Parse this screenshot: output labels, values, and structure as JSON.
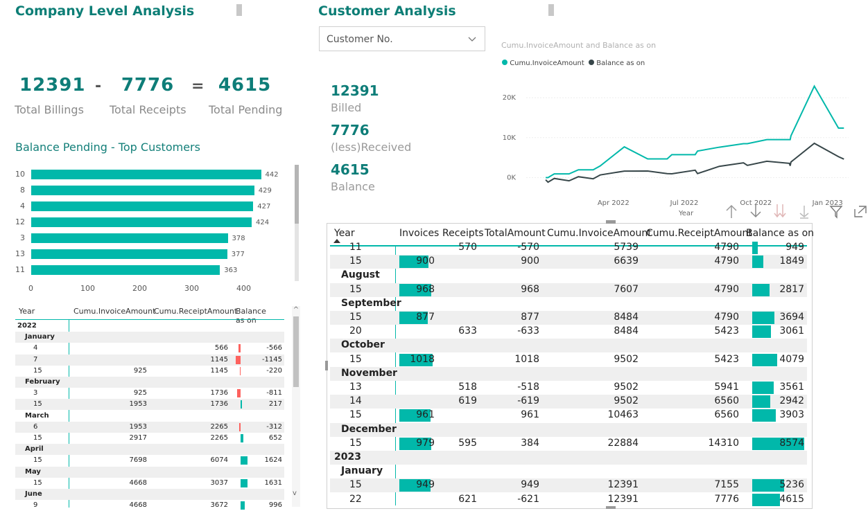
{
  "company": {
    "title": "Company Level Analysis",
    "kpis": {
      "billings": "12391",
      "receipts": "7776",
      "pending": "4615",
      "minus": "-",
      "equals": "=",
      "billings_label": "Total Billings",
      "receipts_label": "Total Receipts",
      "pending_label": "Total Pending"
    },
    "bar_title": "Balance Pending - Top Customers"
  },
  "customer": {
    "title": "Customer Analysis",
    "dropdown_placeholder": "Customer No.",
    "billed": "12391",
    "billed_label": "Billed",
    "received": "7776",
    "received_label": "(less)Received",
    "balance": "4615",
    "balance_label": "Balance",
    "line_title": "Cumu.InvoiceAmount and Balance as on",
    "legend_1": "Cumu.InvoiceAmount",
    "legend_2": "Balance as on",
    "x_axis_title": "Year",
    "x_ticks": [
      "Apr 2022",
      "Jul 2022",
      "Oct 2022",
      "Jan 2023"
    ],
    "y_ticks": [
      "20K",
      "10K",
      "0K"
    ]
  },
  "chart_data": [
    {
      "type": "bar",
      "orientation": "horizontal",
      "title": "Balance Pending - Top Customers",
      "categories": [
        "10",
        "8",
        "4",
        "12",
        "3",
        "13",
        "11"
      ],
      "values": [
        442,
        429,
        427,
        424,
        378,
        377,
        363
      ],
      "xlim": [
        0,
        460
      ],
      "x_ticks": [
        0,
        100,
        200,
        300,
        400
      ],
      "colors": {
        "bar": "#01b8aa"
      }
    },
    {
      "type": "line",
      "title": "Cumu.InvoiceAmount and Balance as on",
      "xlabel": "Year",
      "ylim": [
        -2000,
        24000
      ],
      "colors": {
        "Cumu.InvoiceAmount": "#01b8aa",
        "Balance as on": "#374649"
      },
      "series": [
        {
          "name": "Cumu.InvoiceAmount",
          "x": [
            "2022-01-04",
            "2022-01-07",
            "2022-01-15",
            "2022-02-03",
            "2022-02-15",
            "2022-03-06",
            "2022-03-15",
            "2022-04-15",
            "2022-05-15",
            "2022-06-09",
            "2022-06-15",
            "2022-07-15",
            "2022-07-18",
            "2022-08-15",
            "2022-09-15",
            "2022-09-20",
            "2022-10-15",
            "2022-11-13",
            "2022-11-14",
            "2022-11-15",
            "2022-12-15",
            "2023-01-15",
            "2023-01-22"
          ],
          "values": [
            0,
            0,
            925,
            925,
            1953,
            1953,
            2917,
            7698,
            4668,
            4668,
            5739,
            5739,
            6639,
            7607,
            8484,
            8484,
            9502,
            9502,
            9502,
            10463,
            22884,
            12391,
            12391
          ]
        },
        {
          "name": "Balance as on",
          "x": [
            "2022-01-04",
            "2022-01-07",
            "2022-01-15",
            "2022-02-03",
            "2022-02-15",
            "2022-03-06",
            "2022-03-15",
            "2022-04-15",
            "2022-05-15",
            "2022-06-09",
            "2022-06-15",
            "2022-07-15",
            "2022-07-18",
            "2022-08-15",
            "2022-09-15",
            "2022-09-20",
            "2022-10-15",
            "2022-11-13",
            "2022-11-14",
            "2022-11-15",
            "2022-12-15",
            "2023-01-15",
            "2023-01-22"
          ],
          "values": [
            -566,
            -1145,
            -220,
            -811,
            217,
            -312,
            652,
            1624,
            1631,
            996,
            949,
            1849,
            1000,
            2817,
            3694,
            3061,
            4079,
            3561,
            2942,
            3903,
            8574,
            5236,
            4615
          ]
        }
      ]
    }
  ],
  "left_matrix": {
    "headers": [
      "Year",
      "Cumu.InvoiceAmount",
      "Cumu.ReceiptAmount",
      "Balance as on"
    ],
    "rows": [
      {
        "label": "2022",
        "kind": "year"
      },
      {
        "label": "January",
        "kind": "month"
      },
      {
        "label": "4",
        "inv": "",
        "rec": "566",
        "bal": "-566",
        "bar": -566
      },
      {
        "label": "7",
        "inv": "",
        "rec": "1145",
        "bal": "-1145",
        "bar": -1145
      },
      {
        "label": "15",
        "inv": "925",
        "rec": "1145",
        "bal": "-220",
        "bar": -220
      },
      {
        "label": "February",
        "kind": "month"
      },
      {
        "label": "3",
        "inv": "925",
        "rec": "1736",
        "bal": "-811",
        "bar": -811
      },
      {
        "label": "15",
        "inv": "1953",
        "rec": "1736",
        "bal": "217",
        "bar": 217
      },
      {
        "label": "March",
        "kind": "month"
      },
      {
        "label": "6",
        "inv": "1953",
        "rec": "2265",
        "bal": "-312",
        "bar": -312
      },
      {
        "label": "15",
        "inv": "2917",
        "rec": "2265",
        "bal": "652",
        "bar": 652
      },
      {
        "label": "April",
        "kind": "month"
      },
      {
        "label": "15",
        "inv": "7698",
        "rec": "6074",
        "bal": "1624",
        "bar": 1624
      },
      {
        "label": "May",
        "kind": "month"
      },
      {
        "label": "15",
        "inv": "4668",
        "rec": "3037",
        "bal": "1631",
        "bar": 1631
      },
      {
        "label": "June",
        "kind": "month"
      },
      {
        "label": "9",
        "inv": "4668",
        "rec": "3672",
        "bal": "996",
        "bar": 996
      }
    ]
  },
  "right_matrix": {
    "headers": [
      "Year",
      "Invoices",
      "Receipts",
      "TotalAmount",
      "Cumu.InvoiceAmount",
      "Cumu.ReceiptAmount",
      "Balance as on"
    ],
    "rows": [
      {
        "label": "11",
        "inv": "",
        "rec": "570",
        "tot": "-570",
        "cinv": "5739",
        "crec": "4790",
        "bal": "949",
        "invbar": 0,
        "balbar": 949
      },
      {
        "label": "15",
        "inv": "900",
        "rec": "",
        "tot": "900",
        "cinv": "6639",
        "crec": "4790",
        "bal": "1849",
        "invbar": 900,
        "balbar": 1849
      },
      {
        "label": "August",
        "kind": "month"
      },
      {
        "label": "15",
        "inv": "968",
        "rec": "",
        "tot": "968",
        "cinv": "7607",
        "crec": "4790",
        "bal": "2817",
        "invbar": 968,
        "balbar": 2817
      },
      {
        "label": "September",
        "kind": "month"
      },
      {
        "label": "15",
        "inv": "877",
        "rec": "",
        "tot": "877",
        "cinv": "8484",
        "crec": "4790",
        "bal": "3694",
        "invbar": 877,
        "balbar": 3694
      },
      {
        "label": "20",
        "inv": "",
        "rec": "633",
        "tot": "-633",
        "cinv": "8484",
        "crec": "5423",
        "bal": "3061",
        "invbar": 0,
        "balbar": 3061
      },
      {
        "label": "October",
        "kind": "month"
      },
      {
        "label": "15",
        "inv": "1018",
        "rec": "",
        "tot": "1018",
        "cinv": "9502",
        "crec": "5423",
        "bal": "4079",
        "invbar": 1018,
        "balbar": 4079
      },
      {
        "label": "November",
        "kind": "month"
      },
      {
        "label": "13",
        "inv": "",
        "rec": "518",
        "tot": "-518",
        "cinv": "9502",
        "crec": "5941",
        "bal": "3561",
        "invbar": 0,
        "balbar": 3561
      },
      {
        "label": "14",
        "inv": "",
        "rec": "619",
        "tot": "-619",
        "cinv": "9502",
        "crec": "6560",
        "bal": "2942",
        "invbar": 0,
        "balbar": 2942
      },
      {
        "label": "15",
        "inv": "961",
        "rec": "",
        "tot": "961",
        "cinv": "10463",
        "crec": "6560",
        "bal": "3903",
        "invbar": 961,
        "balbar": 3903
      },
      {
        "label": "December",
        "kind": "month"
      },
      {
        "label": "15",
        "inv": "979",
        "rec": "595",
        "tot": "384",
        "cinv": "22884",
        "crec": "14310",
        "bal": "8574",
        "invbar": 979,
        "balbar": 8574
      },
      {
        "label": "2023",
        "kind": "year"
      },
      {
        "label": "January",
        "kind": "month"
      },
      {
        "label": "15",
        "inv": "949",
        "rec": "",
        "tot": "949",
        "cinv": "12391",
        "crec": "7155",
        "bal": "5236",
        "invbar": 949,
        "balbar": 5236
      },
      {
        "label": "22",
        "inv": "",
        "rec": "621",
        "tot": "-621",
        "cinv": "12391",
        "crec": "7776",
        "bal": "4615",
        "invbar": 0,
        "balbar": 4615
      }
    ]
  },
  "colors": {
    "teal": "#01b8aa",
    "dark": "#374649",
    "negative": "#fd625e",
    "title": "#0d7e76"
  }
}
